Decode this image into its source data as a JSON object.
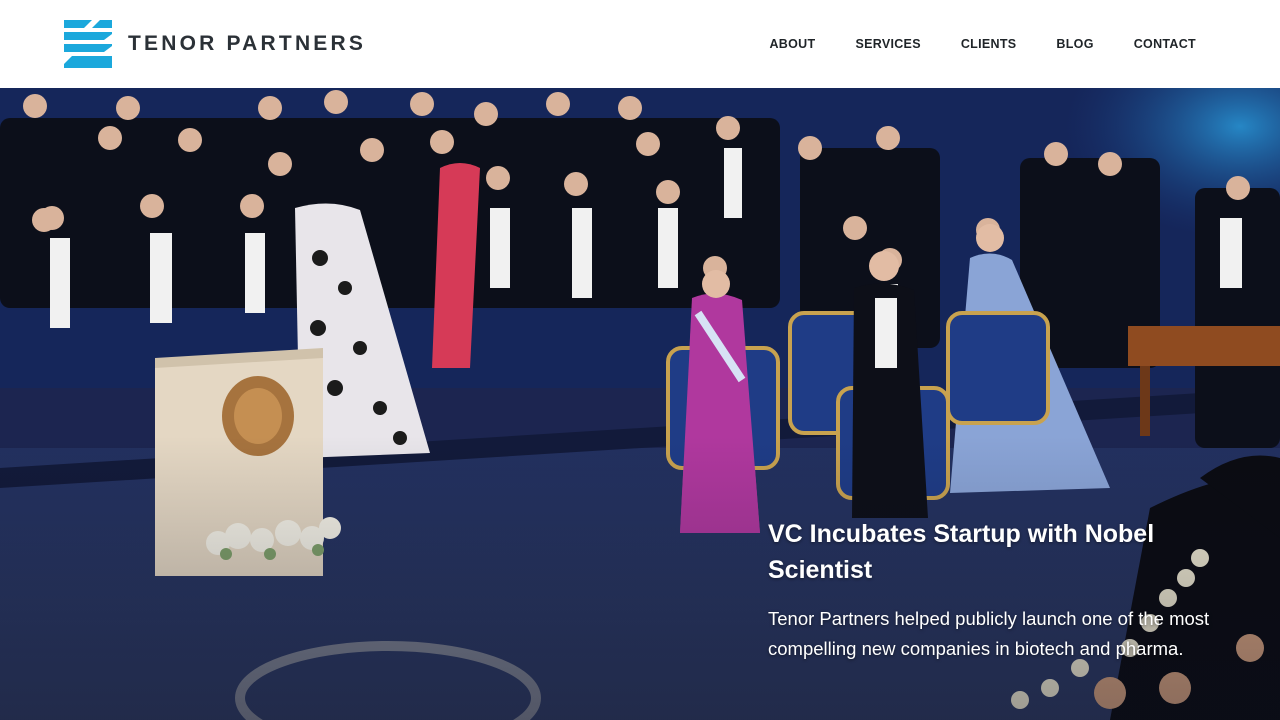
{
  "brand": {
    "name": "TENOR PARTNERS",
    "logo_icon": "stacked-chevron-logo-icon",
    "logo_color": "#1ba8dc"
  },
  "nav": {
    "items": [
      {
        "label": "ABOUT"
      },
      {
        "label": "SERVICES"
      },
      {
        "label": "CLIENTS"
      },
      {
        "label": "BLOG"
      },
      {
        "label": "CONTACT"
      }
    ]
  },
  "hero": {
    "title": "VC Incubates Startup with Nobel Scientist",
    "description": "Tenor Partners helped publicly launch one of the most compelling new companies in biotech and pharma.",
    "accent_colors": {
      "stage": "#1b2a5c",
      "wall": "#12307a"
    }
  }
}
